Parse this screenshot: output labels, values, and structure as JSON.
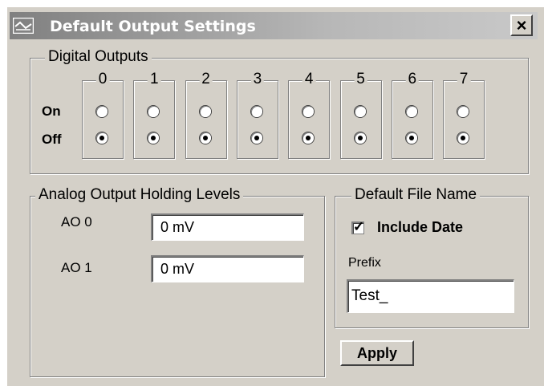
{
  "window": {
    "title": "Default Output Settings",
    "close_label": "×"
  },
  "digital_outputs": {
    "legend": "Digital Outputs",
    "on_label": "On",
    "off_label": "Off",
    "bits": [
      {
        "label": "0",
        "state": "Off"
      },
      {
        "label": "1",
        "state": "Off"
      },
      {
        "label": "2",
        "state": "Off"
      },
      {
        "label": "3",
        "state": "Off"
      },
      {
        "label": "4",
        "state": "Off"
      },
      {
        "label": "5",
        "state": "Off"
      },
      {
        "label": "6",
        "state": "Off"
      },
      {
        "label": "7",
        "state": "Off"
      }
    ]
  },
  "analog_outputs": {
    "legend": "Analog Output Holding Levels",
    "items": [
      {
        "label": "AO 0",
        "value": "0 mV"
      },
      {
        "label": "AO 1",
        "value": "0 mV"
      }
    ]
  },
  "file_name": {
    "legend": "Default File Name",
    "include_date_label": "Include Date",
    "include_date_checked": true,
    "prefix_label": "Prefix",
    "prefix_value": "Test_"
  },
  "apply_label": "Apply"
}
